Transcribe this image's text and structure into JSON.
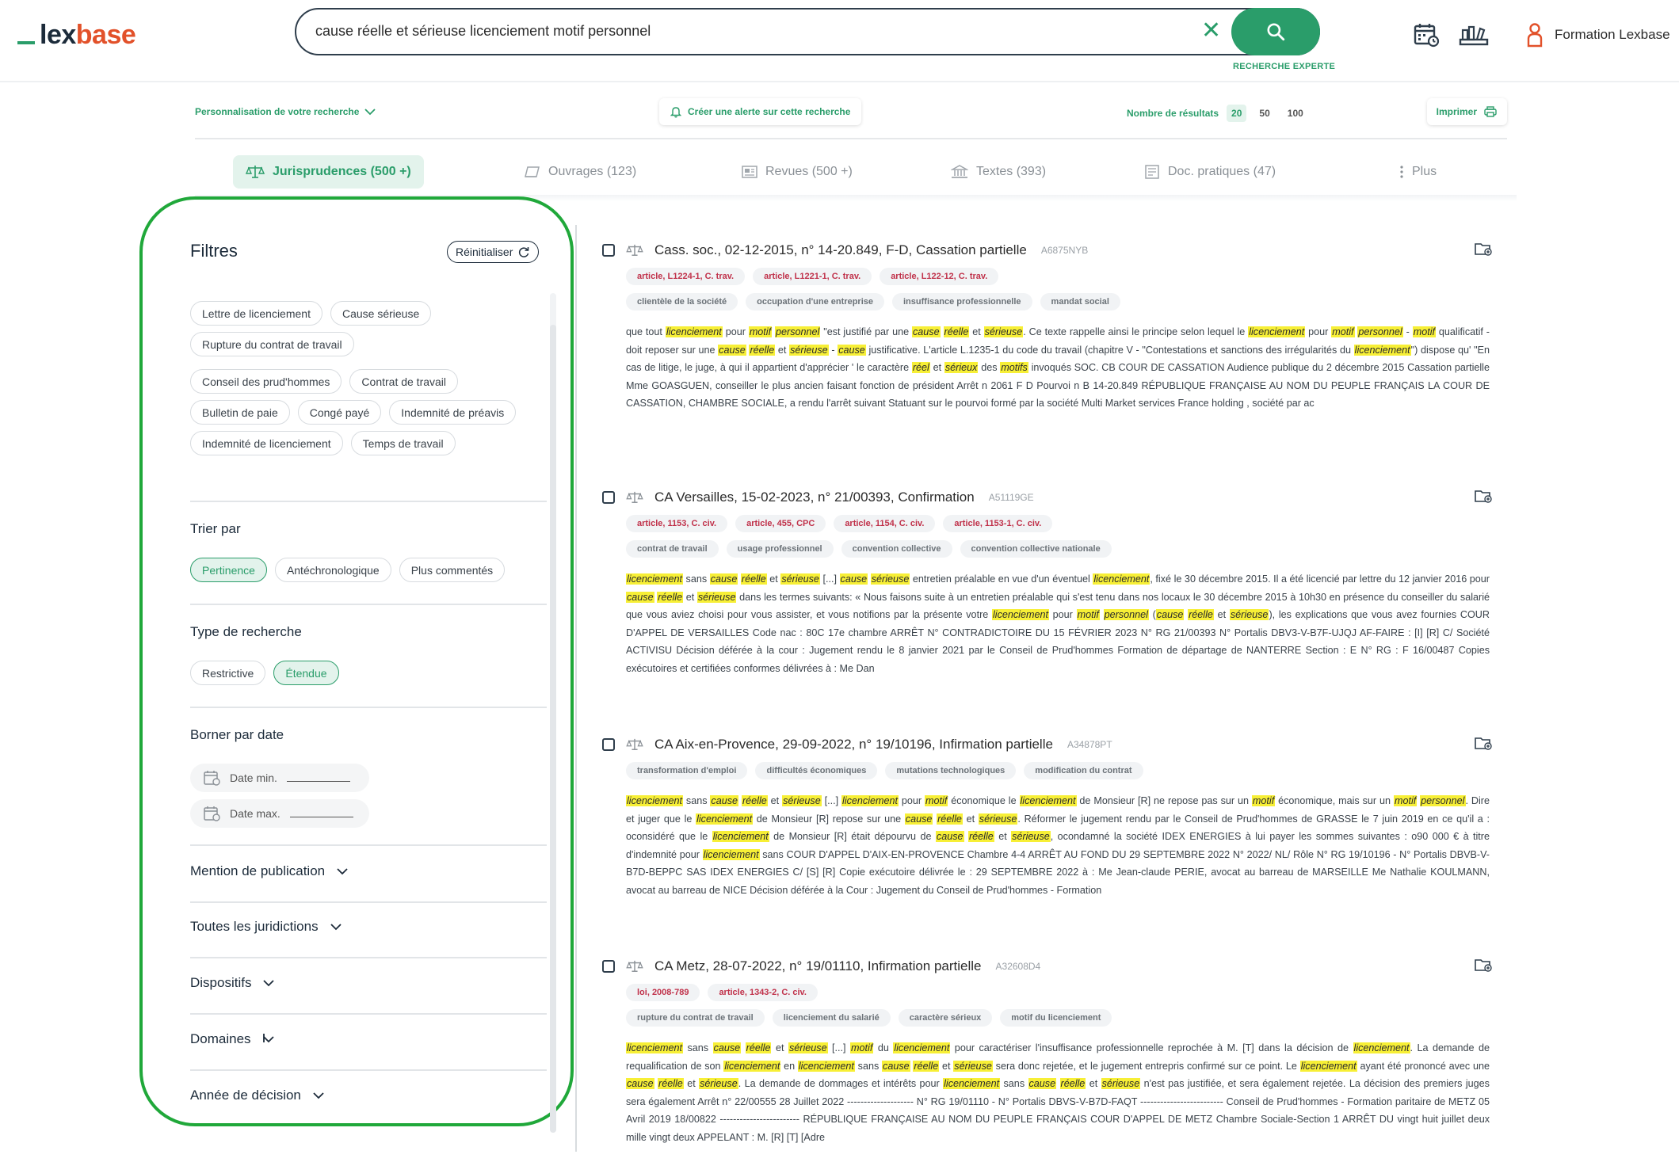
{
  "logo": {
    "part1": "lex",
    "part2": "base"
  },
  "search": {
    "query": "cause réelle et sérieuse licenciement motif personnel",
    "expert_label": "RECHERCHE EXPERTE"
  },
  "user": {
    "name": "Formation Lexbase"
  },
  "toolbar": {
    "personalize_label": "Personnalisation de votre recherche",
    "alert_label": "Créer une alerte sur cette recherche",
    "results_count_label": "Nombre de résultats",
    "results_options": [
      "20",
      "50",
      "100"
    ],
    "print_label": "Imprimer"
  },
  "tabs": [
    {
      "label": "Jurisprudences (500 +)",
      "icon": "scales-icon"
    },
    {
      "label": "Ouvrages (123)",
      "icon": "book-icon"
    },
    {
      "label": "Revues (500 +)",
      "icon": "newspaper-icon"
    },
    {
      "label": "Textes (393)",
      "icon": "institution-icon"
    },
    {
      "label": "Doc. pratiques (47)",
      "icon": "document-icon"
    },
    {
      "label": "Plus",
      "icon": "more-vertical-icon"
    }
  ],
  "filters": {
    "title": "Filtres",
    "reset_label": "Réinitialiser",
    "keywords": [
      "Lettre de licenciement",
      "Cause sérieuse",
      "Rupture du contrat de travail",
      "Conseil des prud'hommes",
      "Contrat de travail",
      "Bulletin de paie",
      "Congé payé",
      "Indemnité de préavis",
      "Indemnité de licenciement",
      "Temps de travail"
    ],
    "sort_title": "Trier par",
    "sort_options": [
      "Pertinence",
      "Antéchronologique",
      "Plus commentés"
    ],
    "type_title": "Type de recherche",
    "type_options": [
      "Restrictive",
      "Étendue"
    ],
    "date_title": "Borner par date",
    "date_min": "Date min.",
    "date_max": "Date max.",
    "accordions": [
      "Mention de publication",
      "Toutes les juridictions",
      "Dispositifs",
      "Domaines",
      "Année de décision"
    ]
  },
  "results": [
    {
      "title": "Cass. soc., 02-12-2015, n° 14-20.849, F-D, Cassation partielle",
      "ref": "A6875NYB",
      "articles": [
        "article, L1224-1, C. trav.",
        "article, L1221-1, C. trav.",
        "article, L122-12, C. trav."
      ],
      "tags": [
        "clientèle de la société",
        "occupation d'une entreprise",
        "insuffisance professionnelle",
        "mandat social"
      ],
      "excerpt": "que tout [[licenciement]] pour [[motif]] [[personnel]] \"est justifié par une [[cause]] [[réelle]] et [[sérieuse]]. Ce texte rappelle ainsi le principe selon lequel le [[licenciement]] pour [[motif]] [[personnel]] - [[motif]] qualificatif - doit reposer sur une [[cause]] [[réelle]] et [[sérieuse]] - [[cause]] justificative. L'article L.1235-1 du code du travail (chapitre V - \"Contestations et sanctions des irrégularités du [[licenciement]]\") dispose qu' \"En cas de litige, le juge, à qui il appartient d'apprécier ' le caractère [[réel]] et [[sérieux]] des [[motifs]] invoqués SOC. CB COUR DE CASSATION Audience publique du 2 décembre 2015 Cassation partielle Mme GOASGUEN, conseiller le plus ancien faisant fonction de président Arrêt n 2061 F D Pourvoi n B 14-20.849 RÉPUBLIQUE FRANÇAISE AU NOM DU PEUPLE FRANÇAIS LA COUR DE CASSATION, CHAMBRE SOCIALE, a rendu l'arrêt suivant Statuant sur le pourvoi formé par la société Multi Market services France holding , société par ac"
    },
    {
      "title": "CA Versailles, 15-02-2023, n° 21/00393, Confirmation",
      "ref": "A51119GE",
      "articles": [
        "article, 1153, C. civ.",
        "article, 455, CPC",
        "article, 1154, C. civ.",
        "article, 1153-1, C. civ."
      ],
      "tags": [
        "contrat de travail",
        "usage professionnel",
        "convention collective",
        "convention collective nationale"
      ],
      "excerpt": "[[licenciement]] sans [[cause]] [[réelle]] et [[sérieuse]] [...] [[cause]] [[sérieuse]] entretien préalable en vue d'un éventuel [[licenciement]], fixé le 30 décembre 2015. Il a été licencié par lettre du 12 janvier 2016 pour [[cause]] [[réelle]] et [[sérieuse]] dans les termes suivants: « Nous faisons suite à un entretien préalable qui s'est tenu dans nos locaux le 30 décembre 2015 à 10h30 en présence du conseiller du salarié que vous aviez choisi pour vous assister, et vous notifions par la présente votre [[licenciement]] pour [[motif]] [[personnel]] ([[cause]] [[réelle]] et [[sérieuse]]), les explications que vous avez fournies COUR D'APPEL DE VERSAILLES Code nac : 80C 17e chambre ARRÊT N° CONTRADICTOIRE DU 15 FÉVRIER 2023 N° RG 21/00393 N° Portalis DBV3-V-B7F-UJQJ AF-FAIRE : [I] [R] C/ Société ACTIVISU Décision déférée à la cour : Jugement rendu le 8 janvier 2021 par le Conseil de Prud'hommes Formation de départage de NANTERRE Section : E N° RG : F 16/00487 Copies exécutoires et certifiées conformes délivrées à : Me Dan"
    },
    {
      "title": "CA Aix-en-Provence, 29-09-2022, n° 19/10196, Infirmation partielle",
      "ref": "A34878PT",
      "articles": [],
      "tags": [
        "transformation d'emploi",
        "difficultés économiques",
        "mutations technologiques",
        "modification du contrat"
      ],
      "excerpt": "[[licenciement]] sans [[cause]] [[réelle]] et [[sérieuse]] [...] [[licenciement]] pour [[motif]] économique le [[licenciement]] de Monsieur [R] ne repose pas sur un [[motif]] économique, mais sur un [[motif]] [[personnel]]. Dire et juger que le [[licenciement]] de Monsieur [R] repose sur une [[cause]] [[réelle]] et [[sérieuse]]. Réformer le jugement rendu par le Conseil de Prud'hommes de GRASSE le 7 juin 2019 en ce qu'il a : oconsidéré que le [[licenciement]] de Monsieur [R] était dépourvu de [[cause]] [[réelle]] et [[sérieuse]], ocondamné la société IDEX ENERGIES à lui payer les sommes suivantes : o90 000 € à titre d'indemnité pour [[licenciement]] sans COUR D'APPEL D'AIX-EN-PROVENCE Chambre 4-4 ARRÊT AU FOND DU 29 SEPTEMBRE 2022 N° 2022/ NL/ Rôle N° RG 19/10196 - N° Portalis DBVB-V-B7D-BEPPC SAS IDEX ENERGIES C/ [S] [R] Copie exécutoire délivrée le : 29 SEPTEMBRE 2022 à : Me Jean-claude PERIE, avocat au barreau de MARSEILLE Me Nathalie KOULMANN, avocat au barreau de NICE Décision déférée à la Cour : Jugement du Conseil de Prud'hommes - Formation"
    },
    {
      "title": "CA Metz, 28-07-2022, n° 19/01110, Infirmation partielle",
      "ref": "A32608D4",
      "articles": [
        "loi, 2008-789",
        "article, 1343-2, C. civ."
      ],
      "tags": [
        "rupture du contrat de travail",
        "licenciement du salarié",
        "caractère sérieux",
        "motif du licenciement"
      ],
      "excerpt": "[[licenciement]] sans [[cause]] [[réelle]] et [[sérieuse]] [...] [[motif]] du [[licenciement]] pour caractériser l'insuffisance professionnelle reprochée à M. [T] dans la décision de [[licenciement]]. La demande de requalification de son [[licenciement]] en [[licenciement]] sans [[cause]] [[réelle]] et [[sérieuse]] sera donc rejetée, et le jugement entrepris confirmé sur ce point. Le [[licenciement]] ayant été prononcé avec une [[cause]] [[réelle]] et [[sérieuse]]. La demande de dommages et intérêts pour [[licenciement]] sans [[cause]] [[réelle]] et [[sérieuse]] n'est pas justifiée, et sera également rejetée. La décision des premiers juges sera également Arrêt n° 22/00555 28 Juillet 2022 -------------------- N° RG 19/01110 - N° Portalis DBVS-V-B7D-FAQT ------------------------- Conseil de Prud'hommes - Formation paritaire de METZ 05 Avril 2019 18/00822 ------------------------ RÉPUBLIQUE FRANÇAISE AU NOM DU PEUPLE FRANÇAIS COUR D'APPEL DE METZ Chambre Sociale-Section 1 ARRÊT DU vingt huit juillet deux mille vingt deux APPELANT : M. [R] [T] [Adre"
    }
  ],
  "colors": {
    "accent": "#2a9d6a",
    "highlight": "#f7ef36",
    "article_tag": "#c0314a",
    "annotation_border": "#20a83a"
  }
}
